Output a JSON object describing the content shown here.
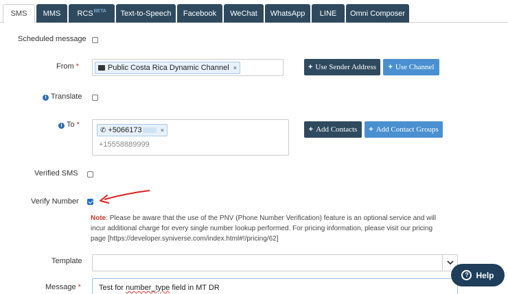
{
  "tabs": [
    {
      "label": "SMS",
      "active": true
    },
    {
      "label": "MMS"
    },
    {
      "label": "RCS",
      "badge": "BETA"
    },
    {
      "label": "Text-to-Speech"
    },
    {
      "label": "Facebook"
    },
    {
      "label": "WeChat"
    },
    {
      "label": "WhatsApp"
    },
    {
      "label": "LINE"
    },
    {
      "label": "Omni Composer"
    }
  ],
  "form": {
    "scheduled_label": "Scheduled message",
    "from_label": "From",
    "from_required": "*",
    "from_chip": "Public Costa Rica Dynamic Channel",
    "chip_remove": "×",
    "use_sender_btn": "Use Sender Address",
    "use_channel_btn": "Use Channel",
    "translate_label": "Translate",
    "to_label": "To",
    "to_required": "*",
    "to_chip": "+5066173",
    "to_placeholder": "+15558889999",
    "add_contacts_btn": "Add Contacts",
    "add_contact_groups_btn": "Add Contact Groups",
    "verified_sms_label": "Verified SMS",
    "verify_number_label": "Verify Number",
    "verify_number_checked": true,
    "note_prefix": "Note",
    "note_text": ": Please be aware that the use of the PNV (Phone Number Verification) feature is an optional service and will incur additional charge for every single number lookup performed. For pricing information, please visit our pricing page ",
    "note_link": "[https://developer.syniverse.com/index.html#!/pricing/62]",
    "template_label": "Template",
    "message_label": "Message",
    "message_required": "*",
    "message_prefix": "Test for ",
    "message_misspelled": "number_type",
    "message_suffix": " field in MT DR"
  },
  "help": {
    "label": "Help"
  },
  "colors": {
    "dark_button": "#2f4a5f",
    "light_button": "#4a90d0",
    "note": "#c0392b",
    "arrow": "#d22"
  }
}
